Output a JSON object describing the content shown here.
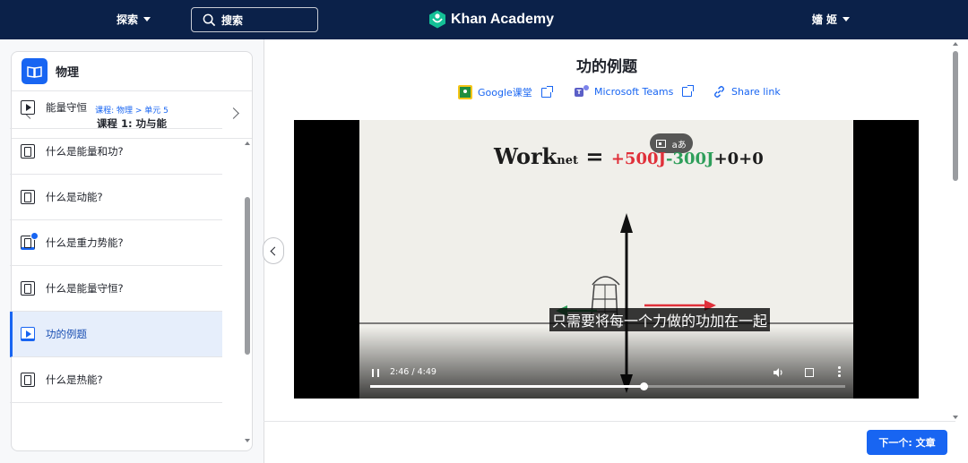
{
  "topbar": {
    "explore_label": "探索",
    "search_label": "搜索",
    "logo_text": "Khan Academy",
    "user_name": "嬙 姬",
    "bg_color": "#0b2149"
  },
  "sidebar": {
    "course_title": "物理",
    "unit_crumb": "课程: 物理 > 单元 5",
    "lesson_title": "课程 1: 功与能",
    "items": [
      {
        "label": "能量守恒",
        "icon": "play-icon"
      },
      {
        "label": "什么是能量和功?",
        "icon": "document-icon"
      },
      {
        "label": "什么是动能?",
        "icon": "document-icon"
      },
      {
        "label": "什么是重力势能?",
        "icon": "document-icon",
        "completed": true
      },
      {
        "label": "什么是能量守恒?",
        "icon": "document-icon"
      },
      {
        "label": "功的例题",
        "icon": "play-icon",
        "active": true
      },
      {
        "label": "什么是热能?",
        "icon": "document-icon"
      }
    ]
  },
  "main": {
    "title": "功的例题",
    "share": {
      "google_classroom": "Google课堂",
      "microsoft_teams": "Microsoft Teams",
      "share_link": "Share link"
    },
    "video": {
      "equation": {
        "work": "Work",
        "subscript": "net",
        "equals": "=",
        "term1": "+500J",
        "term2": "-300J",
        "term3": "+0+0"
      },
      "caption": "只需要将每一个力做的功加在一起",
      "time": "2:46 / 4:49",
      "progress": 0.575,
      "subtitle_toggle_label": "aあ"
    },
    "next_button": "下一个: 文章"
  },
  "colors": {
    "accent": "#1865f2",
    "equation_red": "#e0303a",
    "equation_green": "#2e9e5a"
  }
}
